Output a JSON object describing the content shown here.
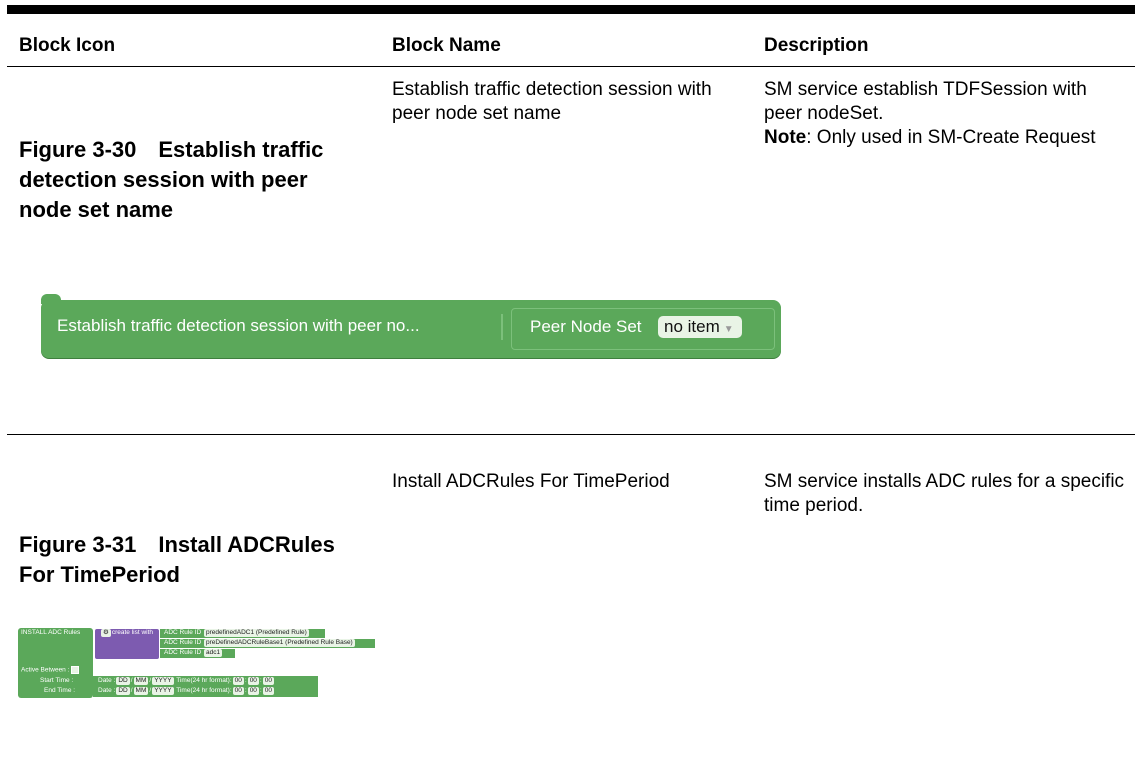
{
  "table": {
    "headers": [
      "Block Icon",
      "Block Name",
      "Description"
    ],
    "rows": [
      {
        "figure_label": "Figure 3-30",
        "figure_title": "Establish traffic detection session with peer node set name",
        "block_name": "Establish traffic detection session with peer node set name",
        "description": "SM service establish TDFSession with peer nodeSet.",
        "note_label": "Note",
        "note_text": ": Only used in SM-Create Request",
        "block_graphic": {
          "main_label": "Establish traffic detection session with peer no...",
          "field_label": "Peer Node Set",
          "dropdown_value": "no item"
        }
      },
      {
        "figure_label": "Figure 3-31",
        "figure_title": "Install ADCRules For TimePeriod",
        "block_name": "Install ADCRules For TimePeriod",
        "description": "SM service installs ADC rules for a specific time period.",
        "block_graphic": {
          "title": "INSTALL ADC Rules",
          "list_label": "create list with",
          "rule_label": "ADC Rule ID",
          "rules": [
            "predefinedADC1 (Predefined Rule)",
            "preDefinedADCRuleBase1 (Predefined Rule Base)",
            "adc1"
          ],
          "active_between": "Active Between :",
          "start_time": "Start Time :",
          "end_time": "End Time :",
          "date_label": "Date :",
          "dd": "DD",
          "mm": "MM",
          "yyyy": "YYYY",
          "time_label": "Time(24 hr format):",
          "time_value": "00"
        }
      }
    ]
  },
  "colors": {
    "block_green": "#5ba85a",
    "block_purple": "#7d5bb0"
  }
}
